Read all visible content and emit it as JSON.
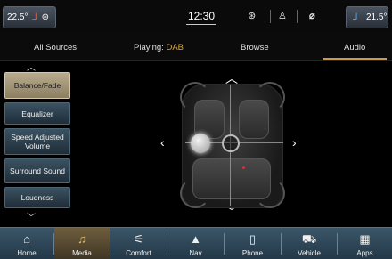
{
  "status_bar": {
    "left_temp": "22.5°",
    "clock": "12:30",
    "right_temp": "21.5°"
  },
  "tabs": [
    {
      "label": "All Sources"
    },
    {
      "label": "Playing:",
      "highlight": "DAB"
    },
    {
      "label": "Browse"
    },
    {
      "label": "Audio"
    }
  ],
  "audio_menu": {
    "items": [
      {
        "label": "Balance/Fade"
      },
      {
        "label": "Equalizer"
      },
      {
        "label": "Speed Adjusted Volume"
      },
      {
        "label": "Surround Sound"
      },
      {
        "label": "Loudness"
      }
    ]
  },
  "bottom_nav": {
    "items": [
      {
        "label": "Home"
      },
      {
        "label": "Media"
      },
      {
        "label": "Comfort"
      },
      {
        "label": "Nav"
      },
      {
        "label": "Phone"
      },
      {
        "label": "Vehicle"
      },
      {
        "label": "Apps"
      }
    ]
  },
  "colors": {
    "accent": "#c89a4a",
    "highlight_text": "#d8a84a",
    "menu_active": "#b9ab8e",
    "nav_bar": "#2d4656"
  }
}
